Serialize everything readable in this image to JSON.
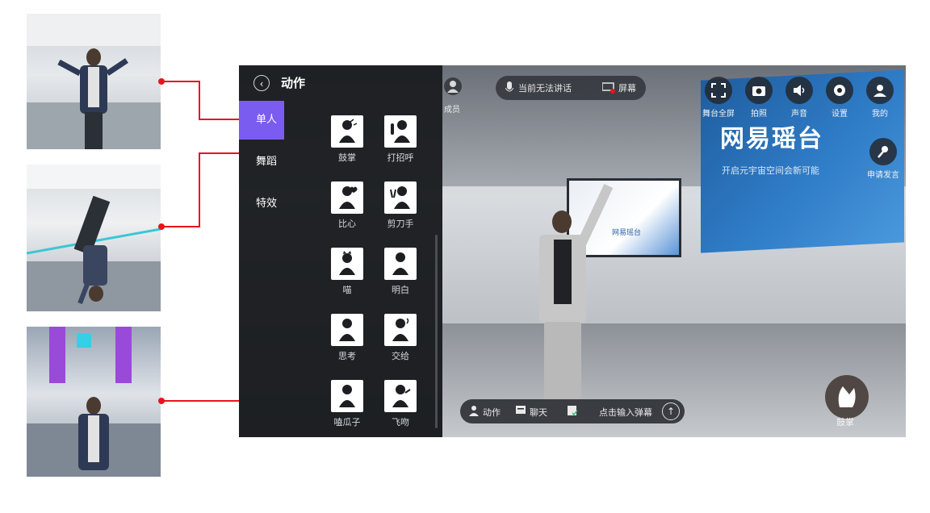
{
  "panel": {
    "title": "动作",
    "categories": [
      "单人",
      "舞蹈",
      "特效"
    ],
    "actions": [
      "鼓掌",
      "打招呼",
      "比心",
      "剪刀手",
      "喵",
      "明白",
      "思考",
      "交给",
      "嗑瓜子",
      "飞吻"
    ]
  },
  "toolbar": {
    "mic_status": "当前无法讲话",
    "screen_share": "屏幕",
    "members": "成员",
    "fullscreen": "舞台全屏",
    "capture": "拍照",
    "sound": "声音",
    "settings": "设置",
    "me": "我的",
    "apply_speak": "申请发言"
  },
  "bottom_bar": {
    "action": "动作",
    "chat": "聊天",
    "placeholder": "点击输入弹幕",
    "send": "↑"
  },
  "scene": {
    "billboard_title": "网易瑶台",
    "billboard_subtitle": "开启元宇宙空间会新可能",
    "screen_logo": "网易瑶台"
  },
  "clap_label": "鼓掌",
  "colors": {
    "accent": "#7b5cf0",
    "connector": "#e8141e",
    "panel_bg": "#141619"
  }
}
